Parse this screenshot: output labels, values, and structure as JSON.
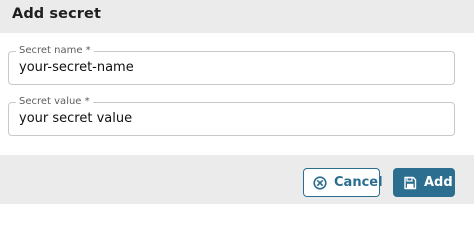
{
  "dialog": {
    "title": "Add secret"
  },
  "fields": {
    "secret_name": {
      "label": "Secret name *",
      "value": "your-secret-name"
    },
    "secret_value": {
      "label": "Secret value *",
      "value": "your secret value"
    }
  },
  "buttons": {
    "cancel": {
      "label": "Cancel",
      "icon": "cancel-circle-icon"
    },
    "add": {
      "label": "Add",
      "icon": "save-floppy-icon"
    }
  },
  "colors": {
    "accent": "#2c6e8f",
    "header_bg": "#ebebeb",
    "footer_bg": "#ebebeb",
    "field_border": "#c9c9c9"
  }
}
